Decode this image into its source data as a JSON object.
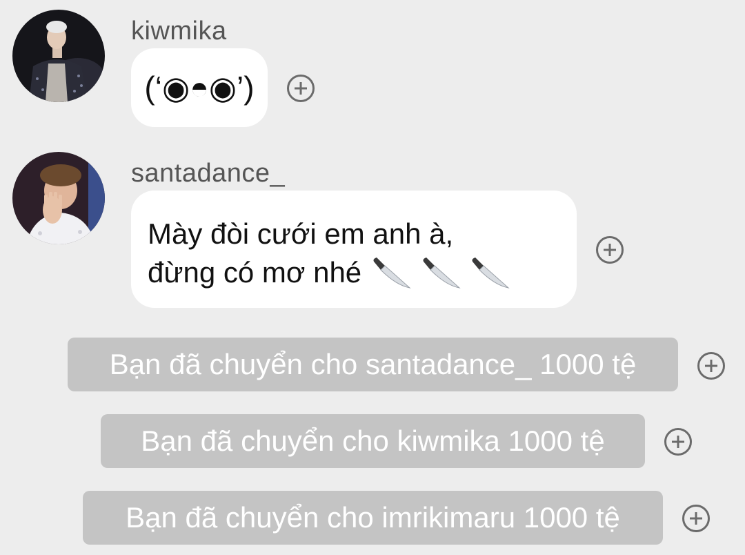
{
  "messages": [
    {
      "username": "kiwmika",
      "text": "(‘◉◓◉’)",
      "avatar_icon": "user-avatar-photo"
    },
    {
      "username": "santadance_",
      "line1": "Mày đòi cưới em anh à,",
      "line2": "đừng có mơ nhé",
      "emoji_icon": "knife-emoji",
      "emoji_count": 3,
      "avatar_icon": "user-avatar-photo"
    }
  ],
  "system_messages": [
    {
      "text": "Bạn đã chuyển cho santadance_ 1000 tệ"
    },
    {
      "text": "Bạn đã chuyển cho kiwmika 1000 tệ"
    },
    {
      "text": "Bạn đã chuyển cho imrikimaru 1000 tệ"
    }
  ],
  "colors": {
    "background": "#ededed",
    "bubble": "#ffffff",
    "system_bubble": "#c4c4c4",
    "username": "#555555",
    "icon": "#6b6b6b"
  },
  "actions": {
    "add_reaction_icon": "plus-circle-icon"
  }
}
